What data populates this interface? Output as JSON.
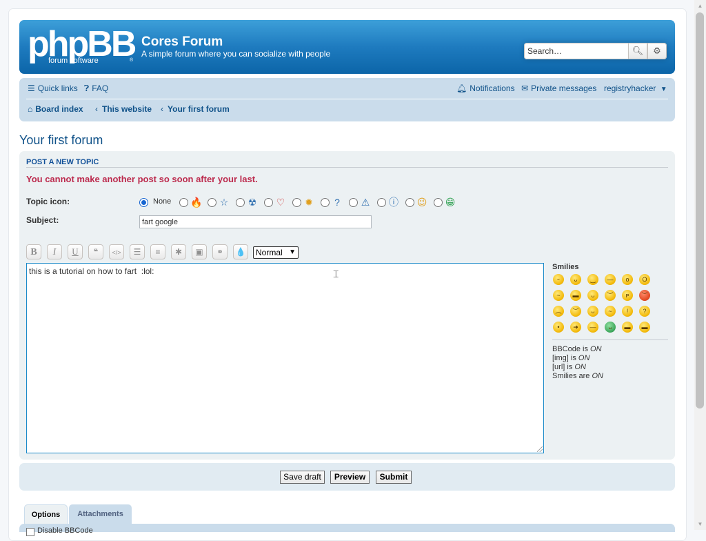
{
  "header": {
    "logo_big": "phpBB",
    "logo_small": "forum  software",
    "logo_reg": "®",
    "site_title": "Cores Forum",
    "site_description": "A simple forum where you can socialize with people",
    "search_placeholder": "Search…",
    "search_icon": "magnifier",
    "advanced_search_icon": "gear"
  },
  "nav": {
    "quick_links": "Quick links",
    "faq": "FAQ",
    "notifications": "Notifications",
    "private_messages": "Private messages",
    "username": "registryhacker",
    "breadcrumbs": [
      "Board index",
      "This website",
      "Your first forum"
    ]
  },
  "page": {
    "forum_title": "Your first forum"
  },
  "posting": {
    "heading": "POST A NEW TOPIC",
    "error": "You cannot make another post so soon after your last.",
    "topic_icon_label": "Topic icon:",
    "topic_icons": [
      {
        "name": "none",
        "label": "None",
        "checked": true
      },
      {
        "name": "fire-icon",
        "glyph": "🔥",
        "color": "#e8703a"
      },
      {
        "name": "star-icon",
        "glyph": "☆",
        "color": "#2f6fb0"
      },
      {
        "name": "radioactive-icon",
        "glyph": "☢",
        "color": "#2f6fb0"
      },
      {
        "name": "heart-icon",
        "glyph": "♡",
        "color": "#d0302f"
      },
      {
        "name": "lightbulb-icon",
        "glyph": "✹",
        "color": "#e0a020"
      },
      {
        "name": "question-icon",
        "glyph": "?",
        "color": "#2f6fb0"
      },
      {
        "name": "warning-icon",
        "glyph": "⚠",
        "color": "#2f6fb0"
      },
      {
        "name": "info-icon",
        "glyph": "ⓘ",
        "color": "#2f6fb0"
      },
      {
        "name": "wink-icon",
        "glyph": "😉",
        "color": "#e0a020"
      },
      {
        "name": "mrgreen-icon",
        "glyph": "😁",
        "color": "#3aa55a"
      }
    ],
    "subject_label": "Subject:",
    "subject_value": "fart google",
    "font_size": "Normal",
    "message": "this is a tutorial on how to fart  :lol:",
    "smilies_label": "Smilies",
    "status": {
      "bbcode": "BBCode is ",
      "bbcode_state": "ON",
      "img": "[img] is ",
      "img_state": "ON",
      "url": "[url] is ",
      "url_state": "ON",
      "smilies": "Smilies are ",
      "smilies_state": "ON"
    }
  },
  "toolbar_buttons": [
    {
      "name": "bold-button",
      "glyph": "B"
    },
    {
      "name": "italic-button",
      "glyph": "I"
    },
    {
      "name": "underline-button",
      "glyph": "U"
    },
    {
      "name": "quote-button",
      "glyph": "❝"
    },
    {
      "name": "code-button",
      "glyph": "</>"
    },
    {
      "name": "list-button",
      "glyph": "☰"
    },
    {
      "name": "ordered-list-button",
      "glyph": "≡"
    },
    {
      "name": "list-item-button",
      "glyph": "✱"
    },
    {
      "name": "image-button",
      "glyph": "▣"
    },
    {
      "name": "link-button",
      "glyph": "⚭"
    },
    {
      "name": "color-button",
      "glyph": "💧"
    }
  ],
  "actions": {
    "save_draft": "Save draft",
    "preview": "Preview",
    "submit": "Submit"
  },
  "tabs": [
    "Options",
    "Attachments"
  ],
  "options": {
    "disable_bbcode": "Disable BBCode"
  }
}
